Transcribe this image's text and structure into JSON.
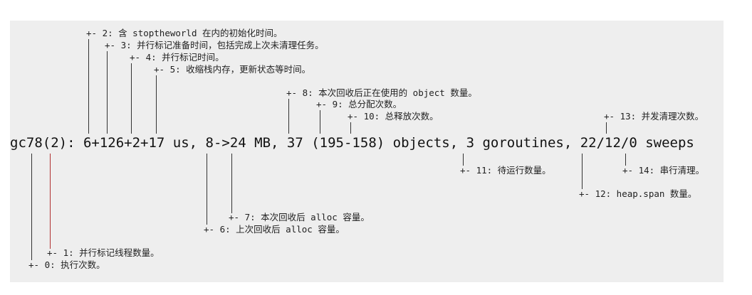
{
  "main_line": "gc78(2): 6+126+2+17 us, 8->24 MB, 37 (195-158) objects, 3 goroutines, 22/12/0 sweeps",
  "annotations": {
    "a0": "+- 0: 执行次数。",
    "a1": "+- 1: 并行标记线程数量。",
    "a2": "+- 2: 含 stoptheworld 在内的初始化时间。",
    "a3": "+- 3: 并行标记准备时间，包括完成上次未清理任务。",
    "a4": "+- 4: 并行标记时间。",
    "a5": "+- 5: 收缩栈内存，更新状态等时间。",
    "a6": "+- 6: 上次回收后 alloc 容量。",
    "a7": "+- 7: 本次回收后 alloc 容量。",
    "a8": "+- 8: 本次回收后正在使用的 object 数量。",
    "a9": "+- 9: 总分配次数。",
    "a10": "+- 10: 总释放次数。",
    "a11": "+- 11: 待运行数量。",
    "a12": "+- 12: heap.span 数量。",
    "a13": "+- 13: 并发清理次数。",
    "a14": "+- 14: 串行清理。"
  },
  "colors": {
    "panel_bg": "#eeeeee",
    "text": "#222222",
    "connector_black": "#333333",
    "connector_red": "#b03030"
  }
}
